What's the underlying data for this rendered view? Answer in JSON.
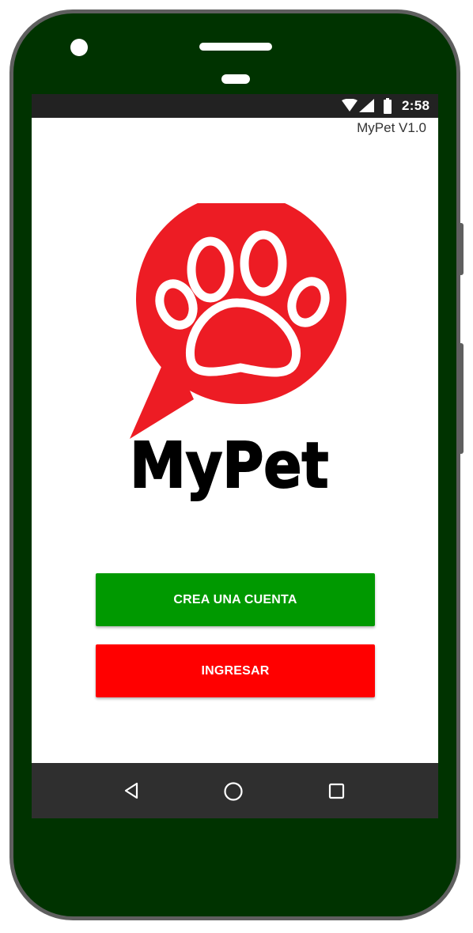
{
  "status_bar": {
    "time": "2:58",
    "icons": [
      "wifi-icon",
      "cell-signal-icon",
      "battery-icon"
    ]
  },
  "app": {
    "version_label": "MyPet V1.0",
    "logo_text": "MyPet",
    "logo_icon": "paw-chat-bubble-icon"
  },
  "buttons": {
    "create_account": "CREA UNA CUENTA",
    "login": "INGRESAR"
  },
  "nav_bar": {
    "icons": [
      "back-icon",
      "home-icon",
      "recents-icon"
    ]
  },
  "colors": {
    "device_body": "#003300",
    "device_border": "#5f5f5f",
    "logo_red": "#ed1c24",
    "create_button": "#009900",
    "login_button": "#ff0000",
    "status_bar": "#222222",
    "nav_bar": "#2f2f2f"
  }
}
